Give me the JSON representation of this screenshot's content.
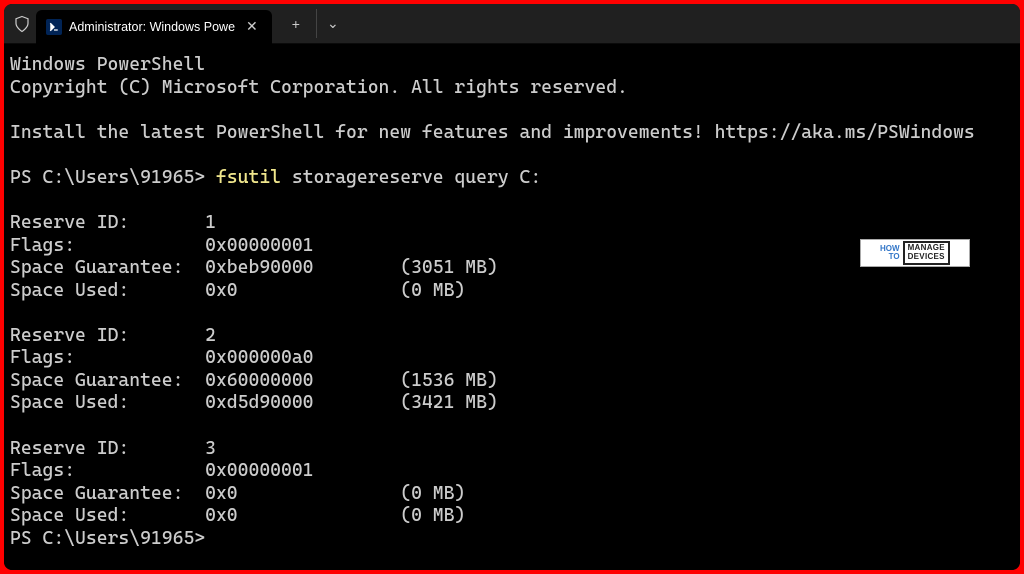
{
  "titlebar": {
    "tab_title": "Administrator: Windows Powe",
    "new_tab_label": "+",
    "dropdown_label": "⌄"
  },
  "terminal": {
    "banner_line1": "Windows PowerShell",
    "banner_line2": "Copyright (C) Microsoft Corporation. All rights reserved.",
    "install_hint": "Install the latest PowerShell for new features and improvements! https://aka.ms/PSWindows",
    "prompt_prefix": "PS C:\\Users\\91965> ",
    "command": "fsutil",
    "command_args": " storagereserve query C:",
    "prompt_after": "PS C:\\Users\\91965>",
    "reserves": [
      {
        "id_label": "Reserve ID:       1",
        "flags_label": "Flags:            0x00000001",
        "guarantee_label": "Space Guarantee:  0xbeb90000        (3051 MB)",
        "used_label": "Space Used:       0x0               (0 MB)"
      },
      {
        "id_label": "Reserve ID:       2",
        "flags_label": "Flags:            0x000000a0",
        "guarantee_label": "Space Guarantee:  0x60000000        (1536 MB)",
        "used_label": "Space Used:       0xd5d90000        (3421 MB)"
      },
      {
        "id_label": "Reserve ID:       3",
        "flags_label": "Flags:            0x00000001",
        "guarantee_label": "Space Guarantee:  0x0               (0 MB)",
        "used_label": "Space Used:       0x0               (0 MB)"
      }
    ]
  },
  "watermark": {
    "left_top": "HOW",
    "left_bottom": "TO",
    "box_top": "MANAGE",
    "box_bottom": "DEVICES"
  }
}
